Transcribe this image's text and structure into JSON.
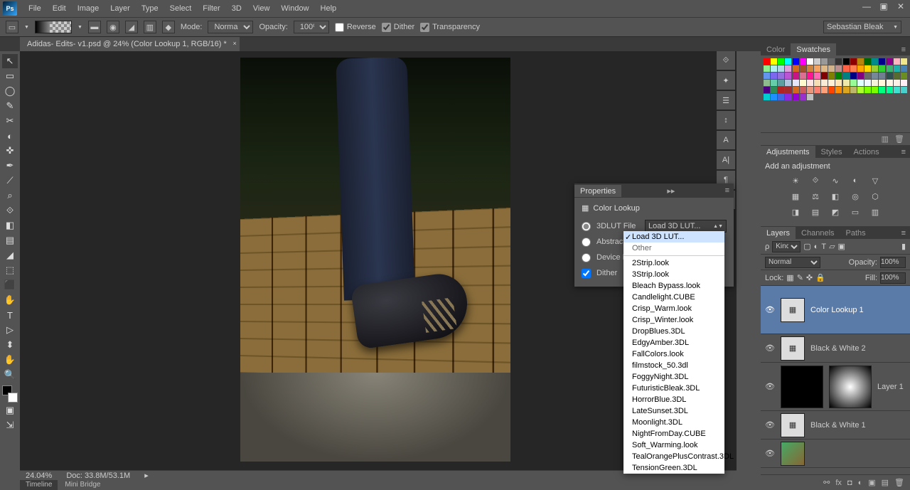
{
  "menus": [
    "File",
    "Edit",
    "Image",
    "Layer",
    "Type",
    "Select",
    "Filter",
    "3D",
    "View",
    "Window",
    "Help"
  ],
  "optionbar": {
    "mode_label": "Mode:",
    "mode_value": "Normal",
    "opacity_label": "Opacity:",
    "opacity_value": "100%",
    "reverse": "Reverse",
    "dither": "Dither",
    "transparency": "Transparency",
    "preset": "Sebastian Bleak"
  },
  "doc_tab": "Adidas- Edits- v1.psd @ 24% (Color Lookup 1, RGB/16) *",
  "status": {
    "zoom": "24.04%",
    "doc": "Doc: 33.8M/53.1M"
  },
  "bottom_tabs": [
    "Timeline",
    "Mini Bridge"
  ],
  "right_panels": {
    "color_tabs": [
      "Color",
      "Swatches"
    ],
    "adj_tabs": [
      "Adjustments",
      "Styles",
      "Actions"
    ],
    "adj_title": "Add an adjustment",
    "layer_tabs": [
      "Layers",
      "Channels",
      "Paths"
    ],
    "layer_filter": "Kind",
    "blend": "Normal",
    "opacity_label": "Opacity:",
    "opacity_value": "100%",
    "lock_label": "Lock:",
    "fill_label": "Fill:",
    "fill_value": "100%",
    "layers": [
      {
        "name": "Color Lookup 1",
        "type": "adj",
        "sel": true,
        "h": "tall"
      },
      {
        "name": "Black & White 2",
        "type": "adj",
        "h": "short"
      },
      {
        "name": "Layer 1",
        "type": "mask",
        "h": "tall"
      },
      {
        "name": "Black & White 1",
        "type": "adj",
        "h": "short"
      }
    ]
  },
  "properties": {
    "panel_tab": "Properties",
    "title": "Color Lookup",
    "rows": [
      {
        "id": "3dlut",
        "label": "3DLUT File",
        "checked": true,
        "select": "Load 3D LUT..."
      },
      {
        "id": "abstract",
        "label": "Abstract",
        "checked": false
      },
      {
        "id": "device",
        "label": "Device Link",
        "checked": false
      }
    ],
    "dither": "Dither"
  },
  "lut_dropdown": {
    "top": [
      "Load 3D LUT...",
      "Other"
    ],
    "list": [
      "2Strip.look",
      "3Strip.look",
      "Bleach Bypass.look",
      "Candlelight.CUBE",
      "Crisp_Warm.look",
      "Crisp_Winter.look",
      "DropBlues.3DL",
      "EdgyAmber.3DL",
      "FallColors.look",
      "filmstock_50.3dl",
      "FoggyNight.3DL",
      "FuturisticBleak.3DL",
      "HorrorBlue.3DL",
      "LateSunset.3DL",
      "Moonlight.3DL",
      "NightFromDay.CUBE",
      "Soft_Warming.look",
      "TealOrangePlusContrast.3DL",
      "TensionGreen.3DL"
    ]
  },
  "swatch_colors": [
    "#ff0000",
    "#ffff00",
    "#00ff00",
    "#00ffff",
    "#0000ff",
    "#ff00ff",
    "#ffffff",
    "#cccccc",
    "#999999",
    "#666666",
    "#333333",
    "#000000",
    "#8b0000",
    "#b8860b",
    "#006400",
    "#008b8b",
    "#00008b",
    "#8b008b",
    "#ffb6c1",
    "#f0e68c",
    "#90ee90",
    "#afeeee",
    "#add8e6",
    "#dda0dd",
    "#d2691e",
    "#a0522d",
    "#cd853f",
    "#f4a460",
    "#deb887",
    "#d2b48c",
    "#bc8f8f",
    "#ff6347",
    "#ff7f50",
    "#ffa500",
    "#ffd700",
    "#9acd32",
    "#32cd32",
    "#3cb371",
    "#20b2aa",
    "#4682b4",
    "#6495ed",
    "#7b68ee",
    "#9370db",
    "#ba55d3",
    "#c71585",
    "#db7093",
    "#ff1493",
    "#ff69b4",
    "#800000",
    "#808000",
    "#008000",
    "#008080",
    "#000080",
    "#800080",
    "#696969",
    "#778899",
    "#708090",
    "#2f4f4f",
    "#556b2f",
    "#6b8e23",
    "#8fbc8f",
    "#66cdaa",
    "#5f9ea0",
    "#b0c4de",
    "#e6e6fa",
    "#fffacd",
    "#ffe4e1",
    "#f5deb3",
    "#faebd7",
    "#ffefd5",
    "#ffe4b5",
    "#eee8aa",
    "#98fb98",
    "#e0ffff",
    "#f0f8ff",
    "#f5f5dc",
    "#fff8dc",
    "#fdf5e6",
    "#faf0e6",
    "#fff0f5",
    "#4b0082",
    "#2e8b57",
    "#b22222",
    "#a52a2a",
    "#d2691e",
    "#cd5c5c",
    "#e9967a",
    "#fa8072",
    "#ffa07a",
    "#ff4500",
    "#ff8c00",
    "#daa520",
    "#bdb76b",
    "#adff2f",
    "#7fff00",
    "#7cfc00",
    "#00ff7f",
    "#00fa9a",
    "#40e0d0",
    "#48d1cc",
    "#00ced1",
    "#1e90ff",
    "#4169e1",
    "#8a2be2",
    "#9400d3",
    "#9932cc",
    "#c0c0c0"
  ],
  "tool_icons": [
    "↖",
    "▭",
    "◯",
    "✎",
    "✂",
    "◐",
    "✜",
    "✒",
    "⟋",
    "⌕",
    "⟐",
    "◧",
    "▤",
    "◢",
    "⬚",
    "⬛",
    "✋",
    "T",
    "▷",
    "⬍",
    "✋",
    "🔍"
  ]
}
